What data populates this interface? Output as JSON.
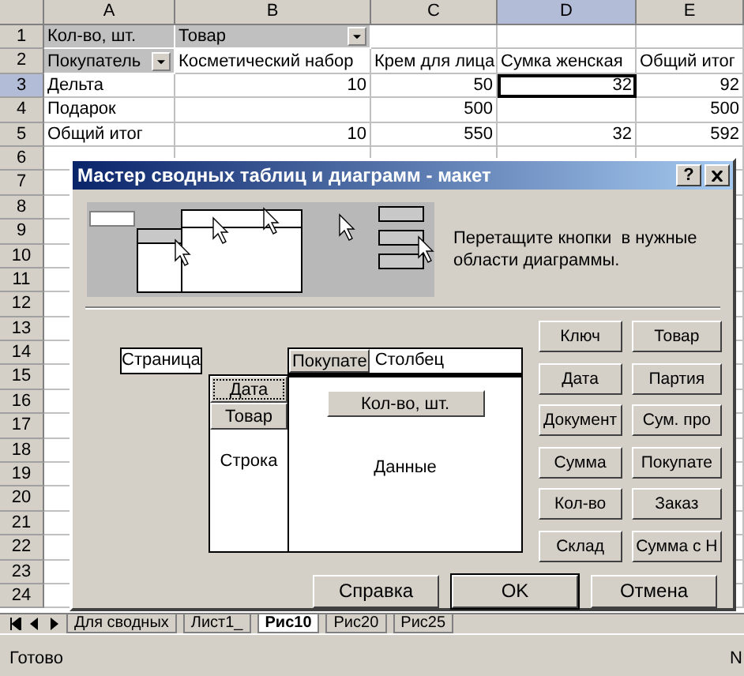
{
  "sheet": {
    "columns": [
      {
        "label": "A",
        "selected": false
      },
      {
        "label": "B",
        "selected": false
      },
      {
        "label": "C",
        "selected": false
      },
      {
        "label": "D",
        "selected": true
      },
      {
        "label": "E",
        "selected": false
      }
    ],
    "rows": [
      {
        "number": "1",
        "selected": false,
        "cells": [
          {
            "kind": "field",
            "text": "Кол-во, шт.",
            "selected": false
          },
          {
            "kind": "dropdown",
            "text": "Товар",
            "selected": false
          },
          {
            "kind": "blank",
            "selected": false
          },
          {
            "kind": "blank",
            "selected": false
          },
          {
            "kind": "blank",
            "selected": false
          }
        ]
      },
      {
        "number": "2",
        "selected": false,
        "cells": [
          {
            "kind": "dropdown",
            "text": "Покупатель",
            "selected": false
          },
          {
            "kind": "text",
            "text": "Косметический набор",
            "selected": false
          },
          {
            "kind": "text",
            "text": "Крем для лица",
            "selected": false
          },
          {
            "kind": "text",
            "text": "Сумка женская",
            "selected": false
          },
          {
            "kind": "text",
            "text": "Общий итог",
            "selected": false
          }
        ]
      },
      {
        "number": "3",
        "selected": true,
        "cells": [
          {
            "kind": "text",
            "text": "Дельта",
            "selected": false
          },
          {
            "kind": "number",
            "text": "10",
            "selected": false
          },
          {
            "kind": "number",
            "text": "50",
            "selected": false
          },
          {
            "kind": "number",
            "text": "32",
            "selected": true
          },
          {
            "kind": "number",
            "text": "92",
            "selected": false
          }
        ]
      },
      {
        "number": "4",
        "selected": false,
        "cells": [
          {
            "kind": "text",
            "text": "Подарок",
            "selected": false
          },
          {
            "kind": "blank",
            "selected": false
          },
          {
            "kind": "number",
            "text": "500",
            "selected": false
          },
          {
            "kind": "blank",
            "selected": false
          },
          {
            "kind": "number",
            "text": "500",
            "selected": false
          }
        ]
      },
      {
        "number": "5",
        "selected": false,
        "cells": [
          {
            "kind": "text",
            "text": "Общий итог",
            "selected": false
          },
          {
            "kind": "number",
            "text": "10",
            "selected": false
          },
          {
            "kind": "number",
            "text": "550",
            "selected": false
          },
          {
            "kind": "number",
            "text": "32",
            "selected": false
          },
          {
            "kind": "number",
            "text": "592",
            "selected": false
          }
        ]
      },
      {
        "number": "6",
        "selected": false
      },
      {
        "number": "7",
        "selected": false
      },
      {
        "number": "8",
        "selected": false
      },
      {
        "number": "9",
        "selected": false
      },
      {
        "number": "10",
        "selected": false
      },
      {
        "number": "11",
        "selected": false
      },
      {
        "number": "12",
        "selected": false
      },
      {
        "number": "13",
        "selected": false
      },
      {
        "number": "14",
        "selected": false
      },
      {
        "number": "15",
        "selected": false
      },
      {
        "number": "16",
        "selected": false
      },
      {
        "number": "17",
        "selected": false
      },
      {
        "number": "18",
        "selected": false
      },
      {
        "number": "19",
        "selected": false
      },
      {
        "number": "20",
        "selected": false
      },
      {
        "number": "21",
        "selected": false
      },
      {
        "number": "22",
        "selected": false
      },
      {
        "number": "23",
        "selected": false
      },
      {
        "number": "24",
        "selected": false
      }
    ],
    "tabs": [
      {
        "label": "Для сводных",
        "selected": false
      },
      {
        "label": "Лист1_",
        "selected": false
      },
      {
        "label": "Рис10",
        "selected": true
      },
      {
        "label": "Рис20",
        "selected": false
      },
      {
        "label": "Рис25",
        "selected": false
      }
    ]
  },
  "dialog": {
    "title": "Мастер сводных таблиц и диаграмм - макет",
    "help_button": "?",
    "hint": "Перетащите кнопки  в нужные области диаграммы.",
    "layout": {
      "page_area": {
        "label": "Страница"
      },
      "column_area": {
        "label": "Столбец",
        "fields": [
          {
            "label": "Покупате",
            "focused": false
          }
        ]
      },
      "row_area": {
        "label": "Строка",
        "fields": [
          {
            "label": "Дата",
            "focused": true
          },
          {
            "label": "Товар",
            "focused": false
          }
        ]
      },
      "data_area": {
        "label": "Данные",
        "fields": [
          {
            "label": "Кол-во, шт.",
            "focused": false
          }
        ]
      }
    },
    "field_buttons": [
      "Ключ",
      "Товар",
      "Дата",
      "Партия",
      "Документ",
      "Сум. про",
      "Сумма",
      "Покупате",
      "Кол-во",
      "Заказ",
      "Склад",
      "Сумма с Н"
    ],
    "buttons": [
      {
        "label": "Справка",
        "default": false
      },
      {
        "label": "OK",
        "default": true
      },
      {
        "label": "Отмена",
        "default": false
      }
    ]
  },
  "status_bar": {
    "status": "Готово",
    "indicator": "N"
  }
}
